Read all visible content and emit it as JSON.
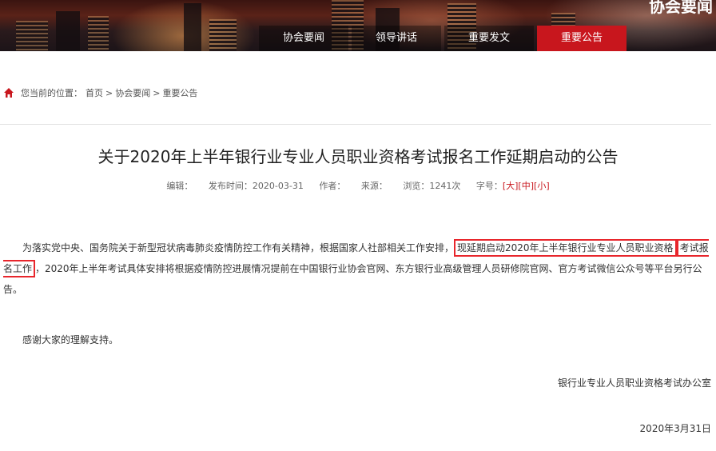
{
  "banner": {
    "title": "协会要闻"
  },
  "nav": {
    "items": [
      "协会要闻",
      "领导讲话",
      "重要发文",
      "重要公告"
    ],
    "active": "重要公告"
  },
  "breadcrumb": {
    "prefix": "您当前的位置：",
    "items": [
      "首页",
      "协会要闻",
      "重要公告"
    ],
    "separator": ">"
  },
  "article": {
    "title": "关于2020年上半年银行业专业人员职业资格考试报名工作延期启动的公告",
    "meta": {
      "editor_label": "编辑：",
      "publish_label": "发布时间：",
      "publish_date": "2020-03-31",
      "author_label": "作者：",
      "source_label": "来源：",
      "views_label": "浏览：",
      "views": "1241次",
      "fontsize_label": "字号：",
      "fontsize_options": [
        "大",
        "中",
        "小"
      ]
    },
    "para1_start": "为落实党中央、国务院关于新型冠状病毒肺炎疫情防控工作有关精神，根据国家人社部相关工作安排，",
    "para1_highlight_a": "现延期启动2020年上半年银行业专业人员职业资格",
    "para1_highlight_b": "考试报名工作",
    "para1_end": "，2020年上半年考试具体安排将根据疫情防控进展情况提前在中国银行业协会官网、东方银行业高级管理人员研修院官网、官方考试微信公众号等平台另行公告。",
    "para2": "感谢大家的理解支持。",
    "signature": "银行业专业人员职业资格考试办公室",
    "date": "2020年3月31日"
  },
  "colors": {
    "accent": "#c8161d",
    "highlight_border": "#e8262c"
  }
}
